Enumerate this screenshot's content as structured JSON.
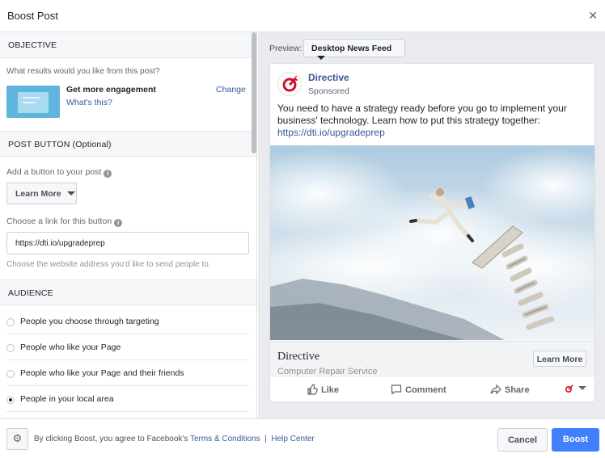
{
  "dialog": {
    "title": "Boost Post",
    "close_icon": "close-icon"
  },
  "objective": {
    "header": "OBJECTIVE",
    "question": "What results would you like from this post?",
    "goal": "Get more engagement",
    "whats_this": "What's this?",
    "change": "Change"
  },
  "post_button": {
    "header": "POST BUTTON (Optional)",
    "add_label": "Add a button to your post",
    "button_value": "Learn More",
    "link_label": "Choose a link for this button",
    "link_value": "https://dti.io/upgradeprep",
    "link_help": "Choose the website address you'd like to send people to."
  },
  "audience": {
    "header": "AUDIENCE",
    "options": [
      {
        "label": "People you choose through targeting",
        "selected": false
      },
      {
        "label": "People who like your Page",
        "selected": false
      },
      {
        "label": "People who like your Page and their friends",
        "selected": false
      },
      {
        "label": "People in your local area",
        "selected": true
      }
    ]
  },
  "preview": {
    "label": "Preview:",
    "placement": "Desktop News Feed",
    "post": {
      "page_name": "Directive",
      "sponsored": "Sponsored",
      "text": "You need to have a strategy ready before you go to implement your business' technology. Learn how to put this strategy together:",
      "link": "https://dti.io/upgradeprep",
      "cta_title": "Directive",
      "cta_desc": "Computer Repair Service",
      "cta_button": "Learn More",
      "actions": {
        "like": "Like",
        "comment": "Comment",
        "share": "Share"
      }
    }
  },
  "footer": {
    "terms_prefix": "By clicking Boost, you agree to Facebook's",
    "terms_link": "Terms & Conditions",
    "separator": "|",
    "help_link": "Help Center",
    "cancel": "Cancel",
    "boost": "Boost"
  },
  "colors": {
    "accent": "#4080ff",
    "link": "#365899",
    "brand_red": "#d0112b"
  }
}
